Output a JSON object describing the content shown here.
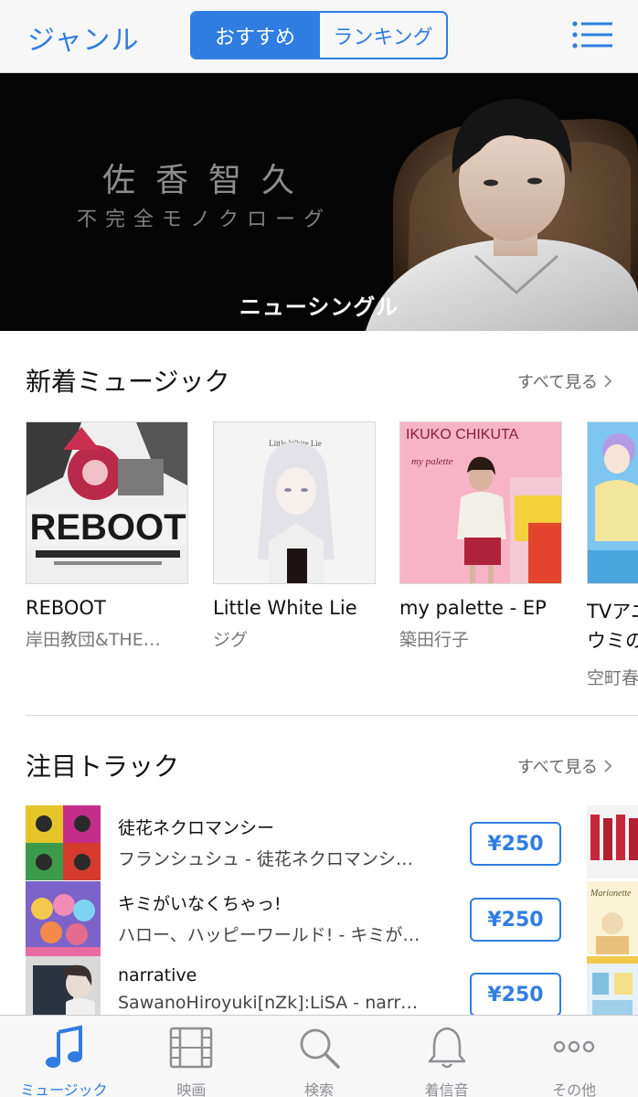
{
  "colors": {
    "accent": "#2f7de1",
    "nav_bg": "#f7f7f8",
    "inactive": "#8e8e93"
  },
  "nav": {
    "left_label": "ジャンル",
    "segments": [
      {
        "label": "おすすめ",
        "selected": true
      },
      {
        "label": "ランキング",
        "selected": false
      }
    ],
    "menu_icon": "list-icon"
  },
  "banner": {
    "title": "佐香智久",
    "subtitle": "不完全モノクローグ",
    "caption": "ニューシングル"
  },
  "new_music": {
    "title": "新着ミュージック",
    "see_all": "すべて見る",
    "albums": [
      {
        "title": "REBOOT",
        "artist": "岸田教団&THE…",
        "cover_text": "REBOOT"
      },
      {
        "title": "Little White Lie",
        "artist": "ジグ",
        "cover_text": "Little White Lie"
      },
      {
        "title": "my palette - EP",
        "artist": "築田行子",
        "cover_text": "IKUKO CHIKUTA"
      },
      {
        "title": "TVアニ",
        "title2": "ウミの",
        "artist": "空町春"
      }
    ]
  },
  "featured_tracks": {
    "title": "注目トラック",
    "see_all": "すべて見る",
    "tracks": [
      {
        "title": "徒花ネクロマンシー",
        "subtitle": "フランシュシュ - 徒花ネクロマンシ…",
        "price": "¥250"
      },
      {
        "title": "キミがいなくちゃっ!",
        "subtitle": "ハロー、ハッピーワールド! - キミが…",
        "price": "¥250"
      },
      {
        "title": "narrative",
        "subtitle": "SawanoHiroyuki[nZk]:LiSA - narr…",
        "price": "¥250"
      }
    ]
  },
  "tabbar": {
    "tabs": [
      {
        "label": "ミュージック",
        "icon": "music-note-icon",
        "active": true
      },
      {
        "label": "映画",
        "icon": "film-icon",
        "active": false
      },
      {
        "label": "検索",
        "icon": "search-icon",
        "active": false
      },
      {
        "label": "着信音",
        "icon": "bell-icon",
        "active": false
      },
      {
        "label": "その他",
        "icon": "more-icon",
        "active": false
      }
    ]
  }
}
